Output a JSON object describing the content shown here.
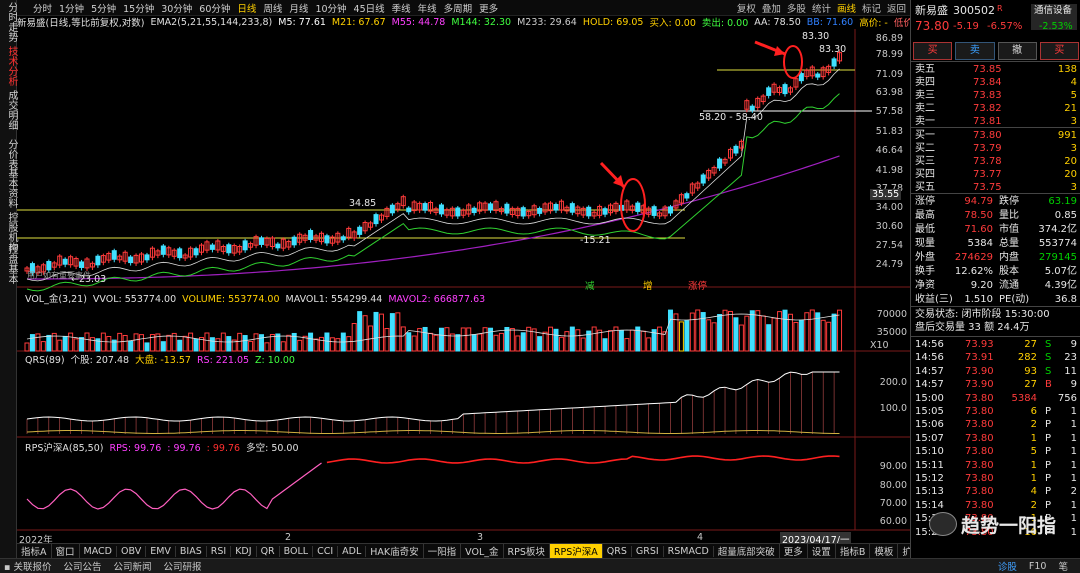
{
  "left_tabs": [
    {
      "label": "分时走势",
      "active": false
    },
    {
      "label": "技术分析",
      "active": true
    },
    {
      "label": "成交明细",
      "active": false
    },
    {
      "label": "分价表",
      "active": false
    },
    {
      "label": "基本资料",
      "active": false
    },
    {
      "label": "控股机构",
      "active": false
    },
    {
      "label": "控盘基本",
      "active": false
    }
  ],
  "toolbar": {
    "periods": [
      "分时",
      "1分钟",
      "5分钟",
      "15分钟",
      "30分钟",
      "60分钟",
      "日线",
      "周线",
      "月线",
      "10分钟",
      "45日线",
      "季线",
      "年线",
      "多周期",
      "更多"
    ],
    "active_period": "日线",
    "right": [
      "复权",
      "叠加",
      "多股",
      "统计",
      "画线",
      "标记",
      "返回"
    ]
  },
  "main_header": [
    {
      "text": "新易盛(日线,等比前复权,对数)",
      "color": "#e0e0e0"
    },
    {
      "text": "EMA2(5,21,55,144,233,8)",
      "color": "#e0e0e0"
    },
    {
      "text": "M5: 77.61",
      "color": "#ffffff"
    },
    {
      "text": "M21: 67.67",
      "color": "#ffd000"
    },
    {
      "text": "M55: 44.78",
      "color": "#ff40ff"
    },
    {
      "text": "M144: 32.30",
      "color": "#40ff40"
    },
    {
      "text": "M233: 29.64",
      "color": "#cccccc"
    },
    {
      "text": "HOLD: 69.05",
      "color": "#ffd000"
    },
    {
      "text": "买入: 0.00",
      "color": "#ffd000"
    },
    {
      "text": "卖出: 0.00",
      "color": "#40ff40"
    },
    {
      "text": "AA: 78.50",
      "color": "#e0e0e0"
    },
    {
      "text": "BB: 71.60",
      "color": "#3080ff"
    },
    {
      "text": "高价: -",
      "color": "#ffd000"
    },
    {
      "text": "低价: -",
      "color": "#ff6060"
    },
    {
      "text": "峰值: 83.30",
      "color": "#ffd000"
    },
    {
      "text": "谷值",
      "color": "#e0e0e0"
    }
  ],
  "price_axis": [
    "86.89",
    "78.99",
    "71.09",
    "63.98",
    "57.58",
    "51.83",
    "46.64",
    "41.98",
    "37.78",
    "34.00",
    "30.60",
    "27.54",
    "24.79"
  ],
  "current_price_tag": "35.55",
  "annotations": {
    "high1": "83.30",
    "high2": "83.30",
    "peak_label": "34.85",
    "low_label": "-15.21",
    "range_label": "58.20 - 58.40",
    "low_start": "←23.03",
    "signals": [
      "减",
      "增",
      "涨停"
    ],
    "watermark": "用户如有重要事件"
  },
  "volume_header": [
    {
      "text": "VOL_金(3,21)",
      "color": "#e0e0e0"
    },
    {
      "text": "VVOL: 553774.00",
      "color": "#e0e0e0"
    },
    {
      "text": "VOLUME: 553774.00",
      "color": "#ffd000"
    },
    {
      "text": "MAVOL1: 554299.44",
      "color": "#e0e0e0"
    },
    {
      "text": "MAVOL2: 666877.63",
      "color": "#ff40ff"
    }
  ],
  "volume_axis": [
    "70000",
    "35000"
  ],
  "volume_unit": "X10",
  "qrs_header": [
    {
      "text": "QRS(89)",
      "color": "#e0e0e0"
    },
    {
      "text": "个股: 207.48",
      "color": "#e0e0e0"
    },
    {
      "text": "大盘: -13.57",
      "color": "#ffd000"
    },
    {
      "text": "RS: 221.05",
      "color": "#ff40ff"
    },
    {
      "text": "Z: 10.00",
      "color": "#40ff40"
    }
  ],
  "qrs_axis": [
    "200.0",
    "100.0"
  ],
  "rps_header": [
    {
      "text": "RPS沪深A(85,50)",
      "color": "#e0e0e0"
    },
    {
      "text": "RPS: 99.76",
      "color": "#ff40ff"
    },
    {
      "text": ": 99.76",
      "color": "#ff40ff"
    },
    {
      "text": ": 99.76",
      "color": "#ff3030"
    },
    {
      "text": "多空: 50.00",
      "color": "#e0e0e0"
    }
  ],
  "rps_axis": [
    "90.00",
    "80.00",
    "70.00",
    "60.00"
  ],
  "x_axis": [
    "2022年",
    "2",
    "3",
    "4"
  ],
  "date_tag": "2023/04/17/一",
  "bottom_tabs": [
    "指标A",
    "窗口",
    "MACD",
    "OBV",
    "EMV",
    "BIAS",
    "RSI",
    "KDJ",
    "QR",
    "BOLL",
    "CCI",
    "ADL",
    "HAK庙奇安",
    "一阳指",
    "VOL_金",
    "RPS板块",
    "RPS沪深A",
    "QRS",
    "GRSI",
    "RSMACD",
    "超量底部突破",
    "更多",
    "设置"
  ],
  "active_bottom_tab": "RPS沪深A",
  "bottom_right": [
    "指标B",
    "模板",
    "扩展"
  ],
  "statusbar": {
    "left": [
      "关联报价",
      "公司公告",
      "公司新闻",
      "公司研报"
    ],
    "right": [
      "诊股",
      "F10",
      "笔"
    ]
  },
  "quote": {
    "name": "新易盛",
    "code": "300502",
    "r_mark": "R",
    "account": "通信设备",
    "price": "73.80",
    "change": "-5.19",
    "pct": "-6.57%",
    "sector_pct": "-2.53%",
    "buttons": [
      "买",
      "卖",
      "撤",
      "买"
    ],
    "asks": [
      {
        "label": "卖五",
        "price": "73.85",
        "vol": "138"
      },
      {
        "label": "卖四",
        "price": "73.84",
        "vol": "4"
      },
      {
        "label": "卖三",
        "price": "73.83",
        "vol": "5"
      },
      {
        "label": "卖二",
        "price": "73.82",
        "vol": "21"
      },
      {
        "label": "卖一",
        "price": "73.81",
        "vol": "3"
      }
    ],
    "bids": [
      {
        "label": "买一",
        "price": "73.80",
        "vol": "991"
      },
      {
        "label": "买二",
        "price": "73.79",
        "vol": "3"
      },
      {
        "label": "买三",
        "price": "73.78",
        "vol": "20"
      },
      {
        "label": "买四",
        "price": "73.77",
        "vol": "20"
      },
      {
        "label": "买五",
        "price": "73.75",
        "vol": "3"
      }
    ],
    "stats": [
      {
        "k1": "涨停",
        "v1": "94.79",
        "k2": "跌停",
        "v2": "63.19",
        "c1": "red",
        "c2": "green"
      },
      {
        "k1": "最高",
        "v1": "78.50",
        "k2": "量比",
        "v2": "0.85",
        "c1": "red",
        "c2": "white"
      },
      {
        "k1": "最低",
        "v1": "71.60",
        "k2": "市值",
        "v2": "374.2亿",
        "c1": "red",
        "c2": "white"
      },
      {
        "k1": "现量",
        "v1": "5384",
        "k2": "总量",
        "v2": "553774",
        "c1": "white",
        "c2": "white"
      },
      {
        "k1": "外盘",
        "v1": "274629",
        "k2": "内盘",
        "v2": "279145",
        "c1": "red",
        "c2": "green"
      },
      {
        "k1": "换手",
        "v1": "12.62%",
        "k2": "股本",
        "v2": "5.07亿",
        "c1": "white",
        "c2": "white"
      },
      {
        "k1": "净资",
        "v1": "9.20",
        "k2": "流通",
        "v2": "4.39亿",
        "c1": "white",
        "c2": "white"
      },
      {
        "k1": "收益(三)",
        "v1": "1.510",
        "k2": "PE(动)",
        "v2": "36.8",
        "c1": "white",
        "c2": "white"
      }
    ],
    "trade_status": "交易状态: 闭市阶段 15:30:00",
    "after_hours": "盘后交易量 33  额 24.4万",
    "ticks": [
      {
        "t": "14:56",
        "p": "73.93",
        "v": "27",
        "d": "S",
        "n": "9"
      },
      {
        "t": "14:56",
        "p": "73.91",
        "v": "282",
        "d": "S",
        "n": "23"
      },
      {
        "t": "14:57",
        "p": "73.90",
        "v": "93",
        "d": "S",
        "n": "11"
      },
      {
        "t": "14:57",
        "p": "73.90",
        "v": "27",
        "d": "B",
        "n": "9"
      },
      {
        "t": "15:00",
        "p": "73.80",
        "v": "5384",
        "d": "",
        "n": "756"
      },
      {
        "t": "15:05",
        "p": "73.80",
        "v": "6",
        "d": "P",
        "n": "1"
      },
      {
        "t": "15:06",
        "p": "73.80",
        "v": "2",
        "d": "P",
        "n": "1"
      },
      {
        "t": "15:07",
        "p": "73.80",
        "v": "1",
        "d": "P",
        "n": "1"
      },
      {
        "t": "15:10",
        "p": "73.80",
        "v": "5",
        "d": "P",
        "n": "1"
      },
      {
        "t": "15:11",
        "p": "73.80",
        "v": "1",
        "d": "P",
        "n": "1"
      },
      {
        "t": "15:12",
        "p": "73.80",
        "v": "1",
        "d": "P",
        "n": "1"
      },
      {
        "t": "15:13",
        "p": "73.80",
        "v": "4",
        "d": "P",
        "n": "2"
      },
      {
        "t": "15:14",
        "p": "73.80",
        "v": "2",
        "d": "P",
        "n": "1"
      },
      {
        "t": "15:17",
        "p": "73.80",
        "v": "1",
        "d": "P",
        "n": "1"
      },
      {
        "t": "15:24",
        "p": "73.80",
        "v": "10",
        "d": "P",
        "n": "1"
      }
    ],
    "watermark": "趋势一阳指"
  },
  "colors": {
    "up": "#ff3b3b",
    "down": "#40e0ff",
    "ma_long": "#a020c0",
    "ma_mid": "#30d030",
    "accent": "#ffd000"
  }
}
